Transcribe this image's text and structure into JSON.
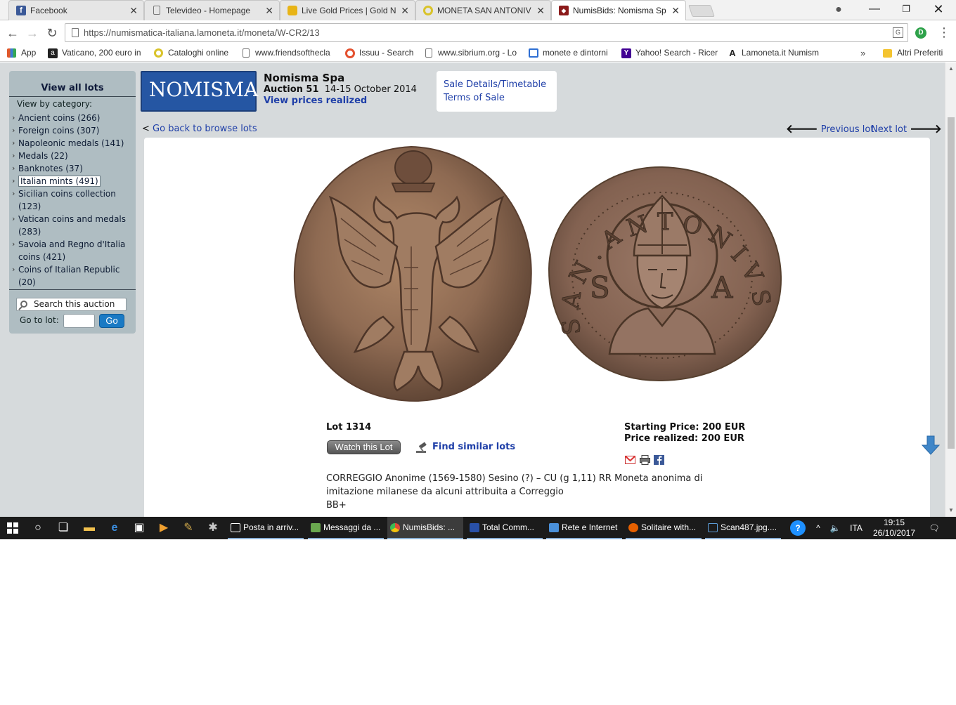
{
  "browser": {
    "tabs": [
      {
        "title": "Facebook",
        "icon": "facebook-icon",
        "color": "#3b5998"
      },
      {
        "title": "Televideo - Homepage",
        "icon": "page-icon",
        "color": "#cccccc"
      },
      {
        "title": "Live Gold Prices | Gold N",
        "icon": "gold-icon",
        "color": "#e8b416"
      },
      {
        "title": "MONETA SAN ANTONIV",
        "icon": "coin-icon",
        "color": "#d9c32a"
      },
      {
        "title": "NumisBids: Nomisma Sp",
        "icon": "numisbids-icon",
        "color": "#8b1a1a"
      }
    ],
    "active_tab_index": 4,
    "url": "https://numismatica-italiana.lamoneta.it/moneta/W-CR2/13",
    "bookmarks": [
      {
        "label": "App",
        "icon": "apps-grid-icon",
        "color": "#e0582b"
      },
      {
        "label": "Vaticano, 200 euro in",
        "icon": "amazon-icon",
        "color": "#222222"
      },
      {
        "label": "Cataloghi online",
        "icon": "coin-icon",
        "color": "#d9c32a"
      },
      {
        "label": "www.friendsofthecla",
        "icon": "page-icon",
        "color": "#ffffff"
      },
      {
        "label": "Issuu - Search",
        "icon": "issuu-icon",
        "color": "#e4502e"
      },
      {
        "label": "www.sibrium.org - Lo",
        "icon": "page-icon",
        "color": "#ffffff"
      },
      {
        "label": "monete e dintorni",
        "icon": "window-icon",
        "color": "#2f6fd3"
      },
      {
        "label": "Yahoo! Search - Ricer",
        "icon": "yahoo-icon",
        "color": "#410093"
      },
      {
        "label": "Lamoneta.it Numism",
        "icon": "lamoneta-icon",
        "color": "#333333"
      }
    ],
    "bookmarks_more": "»",
    "bookmarks_folder": "Altri Preferiti"
  },
  "sidebar": {
    "title": "View all lots",
    "by_category": "View by category:",
    "categories": [
      "Ancient coins (266)",
      "Foreign coins (307)",
      "Napoleonic medals (141)",
      "Medals (22)",
      "Banknotes (37)",
      "Italian mints (491)",
      "Sicilian coins collection (123)",
      "Vatican coins and medals (283)",
      "Savoia and Regno d'Italia coins (421)",
      "Coins of Italian Republic (20)"
    ],
    "selected_category_index": 5,
    "search_placeholder": "Search this auction",
    "goto_label": "Go to lot:",
    "go_button": "Go"
  },
  "auction": {
    "logo_text": "NOMISMA",
    "house": "Nomisma Spa",
    "auction_label": "Auction 51",
    "dates": "14-15 October 2014",
    "prices_link": "View prices realized",
    "sale_details_link": "Sale Details/Timetable",
    "terms_link": "Terms of Sale"
  },
  "navigation": {
    "back_prefix": "<",
    "back_link": "Go back to browse lots",
    "previous_lot": "Previous lot",
    "next_lot": "Next lot"
  },
  "lot": {
    "lot_number": "Lot 1314",
    "watch_button": "Watch this Lot",
    "find_similar": "Find similar lots",
    "starting_price": "Starting Price: 200 EUR",
    "price_realized": "Price realized: 200 EUR",
    "description_line1": "CORREGGIO Anonime (1569-1580) Sesino (?) – CU (g 1,11) RR Moneta anonima di",
    "description_line2": "imitazione milanese da alcuni attribuita a Correggio",
    "grade": "BB+",
    "coin_reverse_legend": "S A N . A N T O N I V S"
  },
  "taskbar": {
    "apps": [
      {
        "label": "Posta in arriv...",
        "icon": "mail-icon",
        "color": "#ffffff"
      },
      {
        "label": "Messaggi da ...",
        "icon": "messages-icon",
        "color": "#6aa84f"
      },
      {
        "label": "NumisBids: ...",
        "icon": "chrome-icon",
        "color": "#dd4b39"
      },
      {
        "label": "Total Comm...",
        "icon": "total-commander-icon",
        "color": "#2950a8"
      },
      {
        "label": "Rete e Internet",
        "icon": "network-icon",
        "color": "#4a90d9"
      },
      {
        "label": "Solitaire with...",
        "icon": "firefox-icon",
        "color": "#e66000"
      },
      {
        "label": "Scan487.jpg....",
        "icon": "image-viewer-icon",
        "color": "#5b9bd5"
      }
    ],
    "active_app_index": 2,
    "language": "ITA",
    "time": "19:15",
    "date": "26/10/2017"
  }
}
